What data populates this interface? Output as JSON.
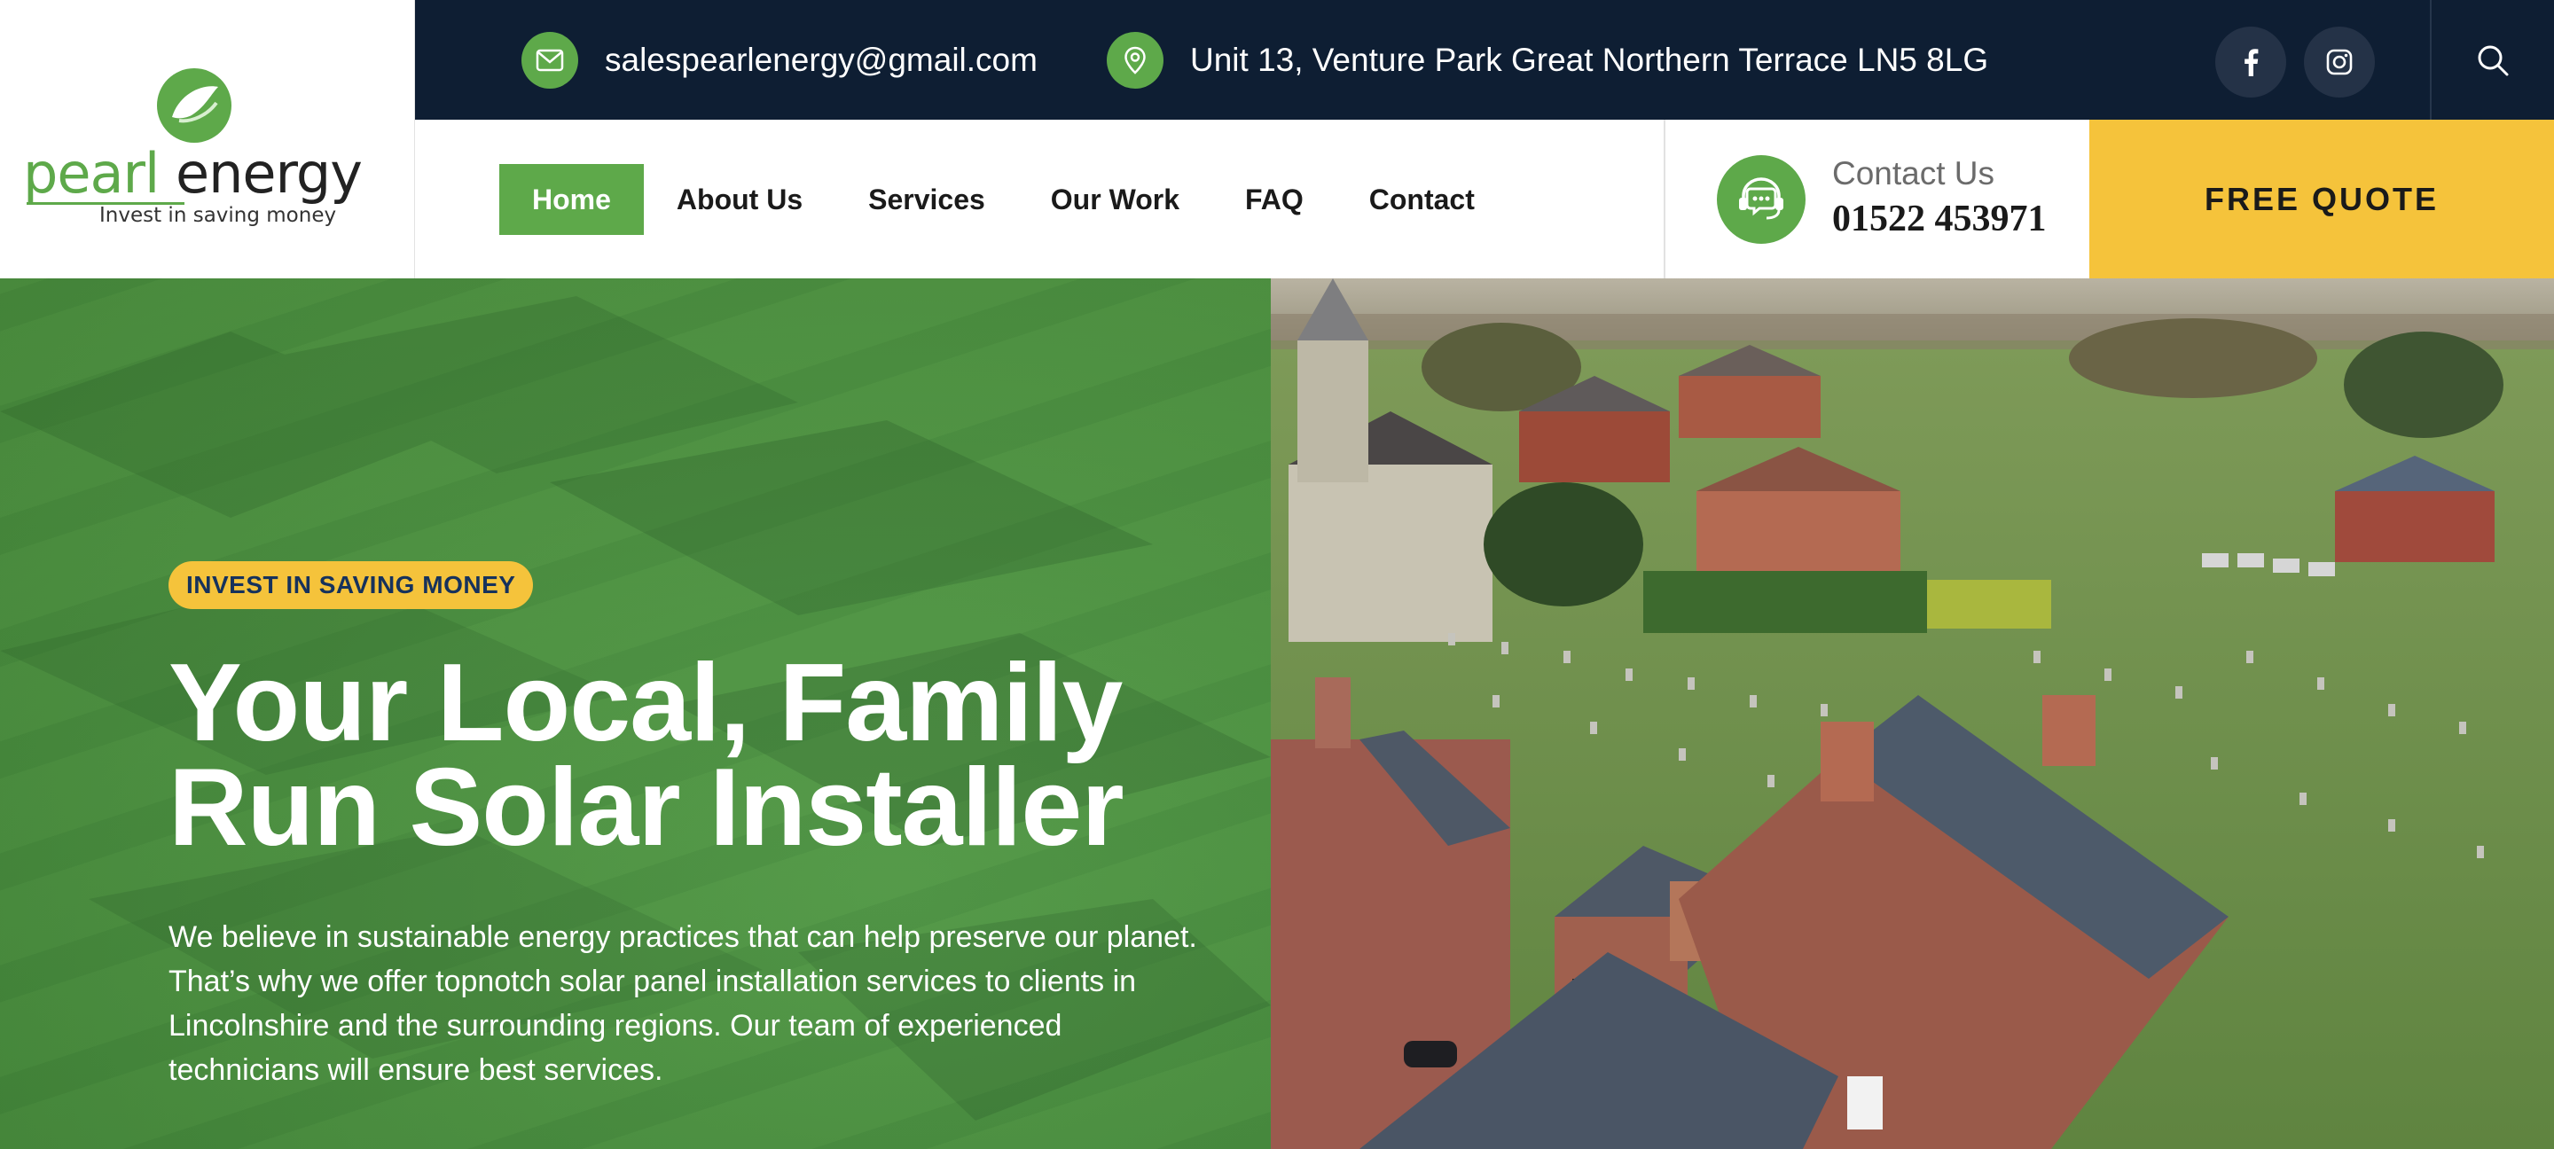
{
  "brand": {
    "name_part1": "pearl",
    "name_part2": "energy",
    "tagline": "Invest in saving money"
  },
  "topbar": {
    "email": "salespearlenergy@gmail.com",
    "address": "Unit 13, Venture Park Great Northern Terrace LN5 8LG",
    "social": [
      "facebook-icon",
      "instagram-icon"
    ]
  },
  "nav": {
    "items": [
      "Home",
      "About Us",
      "Services",
      "Our Work",
      "FAQ",
      "Contact"
    ],
    "active": "Home"
  },
  "contact": {
    "label": "Contact Us",
    "phone": "01522 453971"
  },
  "cta": {
    "quote_label": "FREE QUOTE"
  },
  "hero": {
    "badge": "INVEST IN SAVING MONEY",
    "title_line1": "Your Local, Family",
    "title_line2": "Run Solar Installer",
    "body": "We believe in sustainable energy practices that can help preserve our planet. That’s why we offer topnotch solar panel installation services to clients in Lincolnshire and the surrounding regions. Our team of experienced technicians will ensure best services."
  },
  "colors": {
    "brand_green": "#5ea94a",
    "navy": "#0e1e33",
    "accent_yellow": "#f5c33b"
  }
}
